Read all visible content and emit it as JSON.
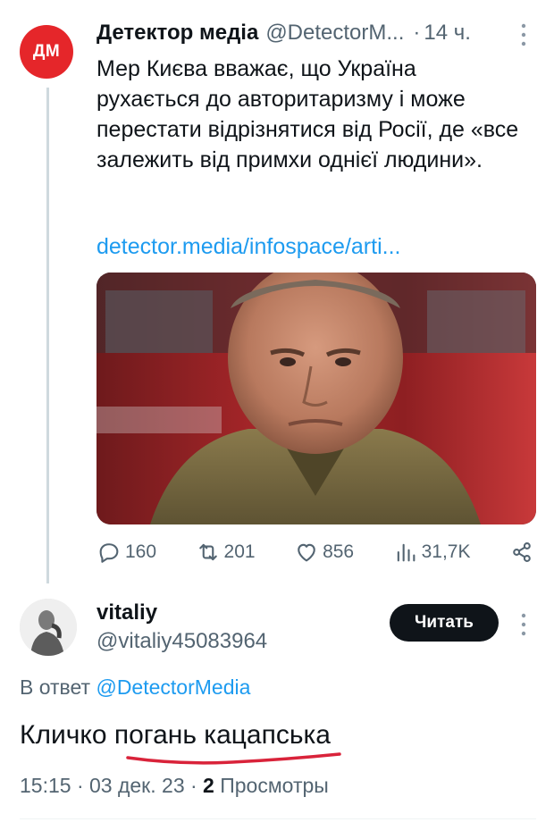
{
  "tweet": {
    "avatar_text": "ДМ",
    "avatar_color": "#e5262a",
    "author_name": "Детектор медіа",
    "author_handle": "@DetectorM...",
    "separator": "·",
    "time": "14 ч.",
    "text": "Мер Києва вважає, що Україна рухається до авторитаризму і може перестати відрізнятися від Росії, де «все залежить від примхи однієї людини».",
    "link": "detector.media/infospace/arti...",
    "image_icon": "photo-of-man-in-military-jacket",
    "stats": {
      "replies": "160",
      "retweets": "201",
      "likes": "856",
      "views": "31,7K"
    }
  },
  "reply": {
    "author_name": "vitaliy",
    "author_handle": "@vitaliy45083964",
    "follow_label": "Читать",
    "reply_to_prefix": "В ответ",
    "reply_to_handle": "@DetectorMedia",
    "text": "Кличко погань кацапська",
    "underline_color": "#d9233a",
    "timestamp": "15:15 · 03 дек. 23 ·",
    "views_count": "2",
    "views_label": "Просмотры"
  },
  "colors": {
    "link": "#1d9bf0",
    "secondary_text": "#536471",
    "primary_text": "#0f1419"
  }
}
